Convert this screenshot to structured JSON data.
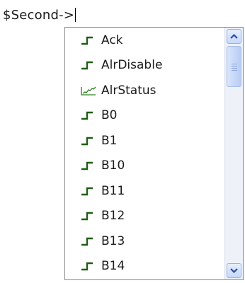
{
  "editor": {
    "text": "$Second->"
  },
  "autocomplete": {
    "items": [
      {
        "label": "Ack",
        "icon": "digital-signal-icon"
      },
      {
        "label": "AlrDisable",
        "icon": "digital-signal-icon"
      },
      {
        "label": "AlrStatus",
        "icon": "analog-signal-icon"
      },
      {
        "label": "B0",
        "icon": "digital-signal-icon"
      },
      {
        "label": "B1",
        "icon": "digital-signal-icon"
      },
      {
        "label": "B10",
        "icon": "digital-signal-icon"
      },
      {
        "label": "B11",
        "icon": "digital-signal-icon"
      },
      {
        "label": "B12",
        "icon": "digital-signal-icon"
      },
      {
        "label": "B13",
        "icon": "digital-signal-icon"
      },
      {
        "label": "B14",
        "icon": "digital-signal-icon"
      }
    ]
  },
  "scrollbar": {
    "up_icon": "chevron-up-icon",
    "down_icon": "chevron-down-icon"
  },
  "colors": {
    "digital_icon": "#1f5c16",
    "analog_icon": "#2e7d20",
    "scroll_arrow": "#2d4fa5"
  }
}
